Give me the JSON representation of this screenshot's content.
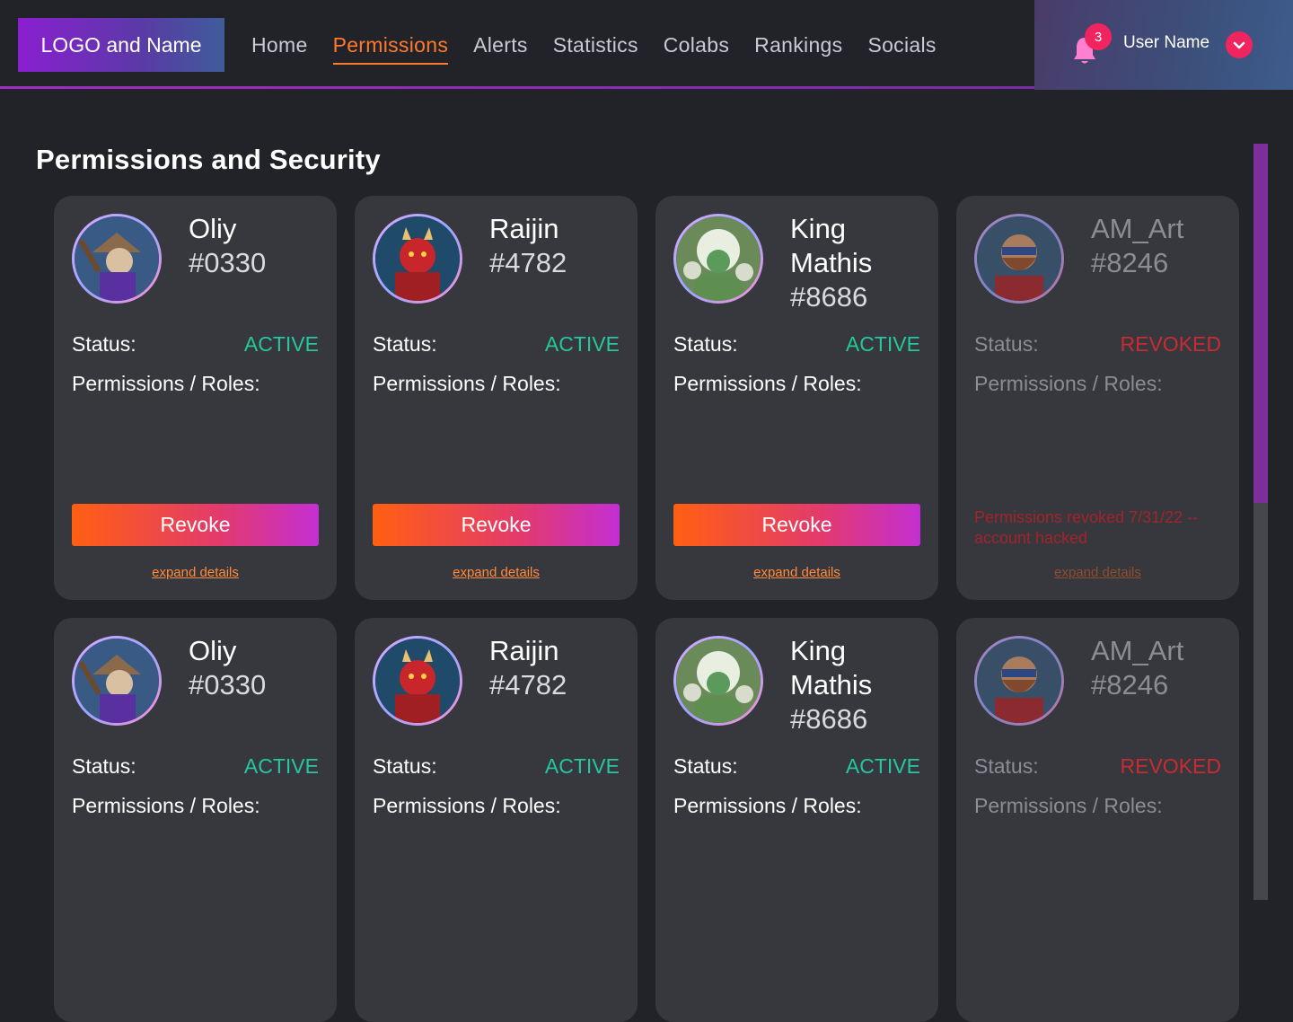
{
  "header": {
    "logo": "LOGO and Name",
    "nav": [
      {
        "label": "Home",
        "active": false
      },
      {
        "label": "Permissions",
        "active": true
      },
      {
        "label": "Alerts",
        "active": false
      },
      {
        "label": "Statistics",
        "active": false
      },
      {
        "label": "Colabs",
        "active": false
      },
      {
        "label": "Rankings",
        "active": false
      },
      {
        "label": "Socials",
        "active": false
      }
    ],
    "notification_count": "3",
    "user_name": "User Name"
  },
  "page": {
    "title": "Permissions and Security"
  },
  "labels": {
    "status": "Status:",
    "roles": "Permissions / Roles:",
    "revoke": "Revoke",
    "expand": "expand details"
  },
  "cards": [
    {
      "name": "Oliy",
      "tag": "#0330",
      "status": "ACTIVE",
      "avatar": "samurai-avatar"
    },
    {
      "name": "Raijin",
      "tag": "#4782",
      "status": "ACTIVE",
      "avatar": "red-oni-avatar"
    },
    {
      "name": "King Mathis",
      "tag": "#8686",
      "status": "ACTIVE",
      "avatar": "white-beast-avatar"
    },
    {
      "name": "AM_Art",
      "tag": "#8246",
      "status": "REVOKED",
      "avatar": "bearded-hero-avatar",
      "note": "Permissions revoked 7/31/22 -- account hacked"
    },
    {
      "name": "Oliy",
      "tag": "#0330",
      "status": "ACTIVE",
      "avatar": "samurai-avatar"
    },
    {
      "name": "Raijin",
      "tag": "#4782",
      "status": "ACTIVE",
      "avatar": "red-oni-avatar"
    },
    {
      "name": "King Mathis",
      "tag": "#8686",
      "status": "ACTIVE",
      "avatar": "white-beast-avatar"
    },
    {
      "name": "AM_Art",
      "tag": "#8246",
      "status": "REVOKED",
      "avatar": "bearded-hero-avatar"
    }
  ],
  "colors": {
    "accent": "#ff7a2e",
    "active": "#26c79a",
    "revoked": "#c92b33",
    "badge": "#f0245f"
  }
}
